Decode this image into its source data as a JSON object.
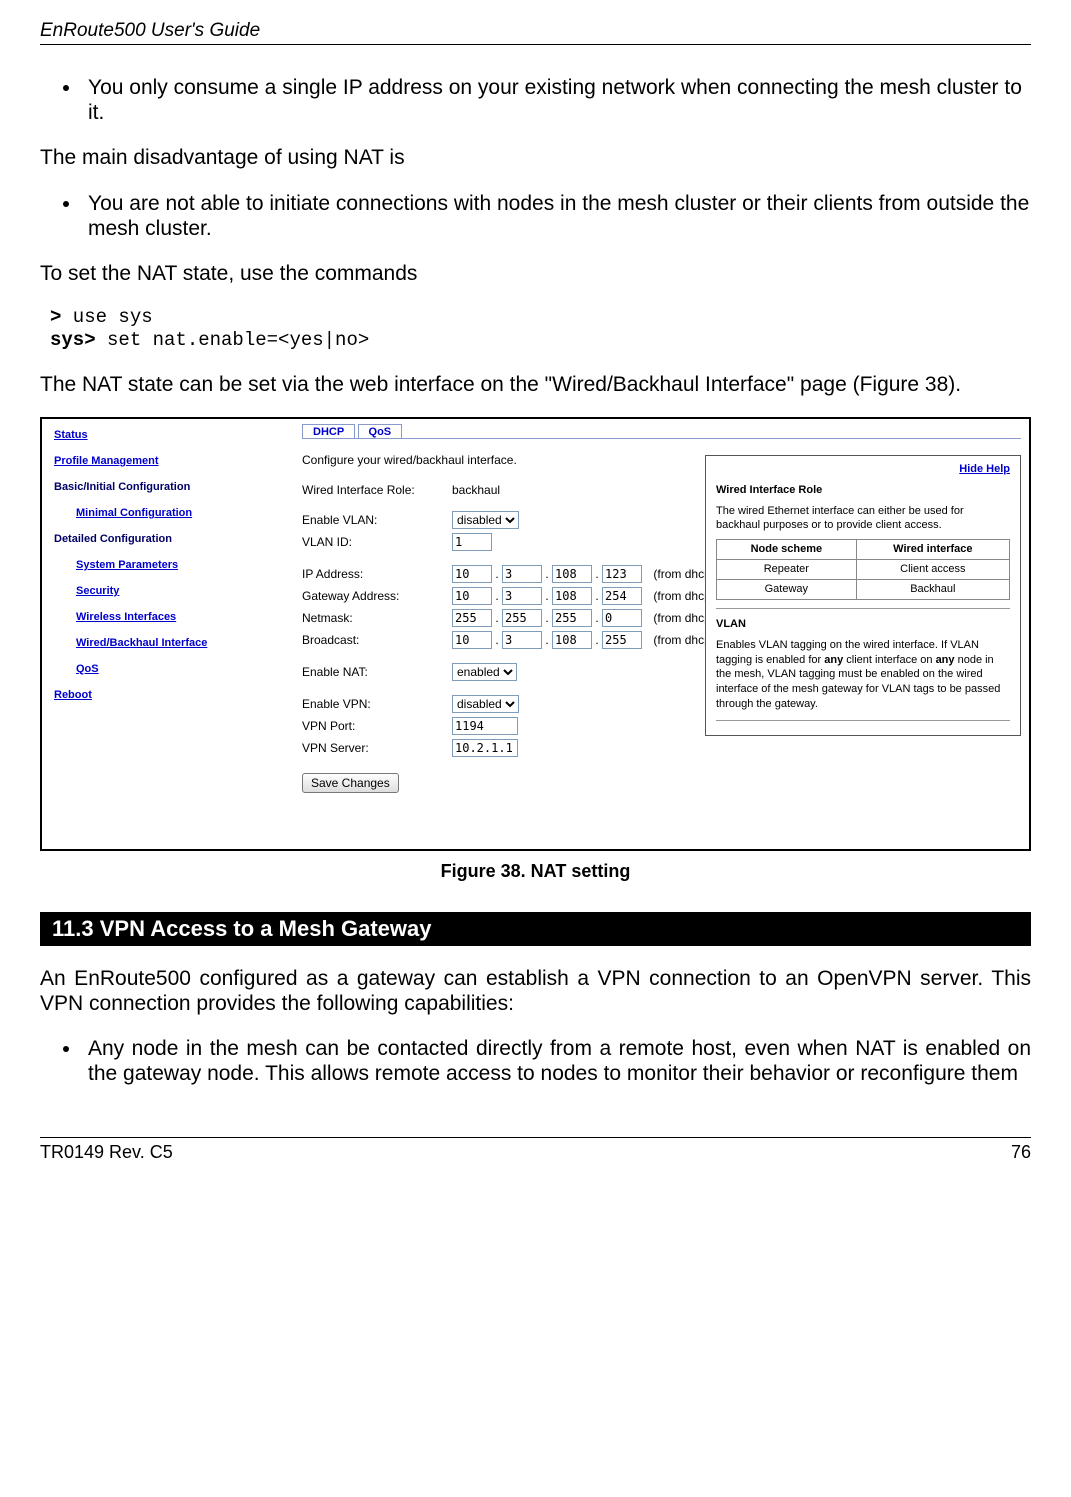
{
  "header": {
    "title": "EnRoute500 User's Guide"
  },
  "content": {
    "bullet1": "You only consume a single IP address on your existing network when connecting the mesh cluster to it.",
    "para1": "The main disadvantage of using NAT is",
    "bullet2": "You are not able to initiate connections with nodes in the mesh cluster or their clients from outside the mesh cluster.",
    "para2": "To set the NAT state, use the commands",
    "cmd": {
      "p1": ">",
      "c1": " use sys",
      "p2": "sys>",
      "c2": " set nat.enable=<yes|no>"
    },
    "para3": "The NAT state can be set via the web interface on the \"Wired/Backhaul Interface\" page (Figure 38).",
    "fig_caption": "Figure 38. NAT setting",
    "section_heading": "11.3    VPN Access to a Mesh Gateway",
    "para4": "An EnRoute500 configured as a gateway can establish a VPN connection to an OpenVPN server. This VPN connection provides the following capabilities:",
    "bullet3": "Any node in the mesh can be contacted directly from a remote host, even when NAT is enabled on the gateway node. This allows remote access to nodes to monitor their behavior or reconfigure them"
  },
  "nav": {
    "status": "Status",
    "profile": "Profile Management",
    "basic": "Basic/Initial Configuration",
    "minimal": "Minimal Configuration",
    "detailed": "Detailed Configuration",
    "sysparam": "System Parameters",
    "security": "Security",
    "wireless": "Wireless Interfaces",
    "wired": "Wired/Backhaul Interface",
    "qos": "QoS",
    "reboot": "Reboot"
  },
  "tabs": {
    "dhcp": "DHCP",
    "qos": "QoS"
  },
  "form": {
    "desc": "Configure your wired/backhaul interface.",
    "role_label": "Wired Interface Role:",
    "role_val": "backhaul",
    "vlan_en_label": "Enable VLAN:",
    "vlan_en_val": "disabled",
    "vlan_id_label": "VLAN ID:",
    "vlan_id_val": "1",
    "ip_label": "IP Address:",
    "ip": {
      "a": "10",
      "b": "3",
      "c": "108",
      "d": "123"
    },
    "gw_label": "Gateway Address:",
    "gw": {
      "a": "10",
      "b": "3",
      "c": "108",
      "d": "254"
    },
    "nm_label": "Netmask:",
    "nm": {
      "a": "255",
      "b": "255",
      "c": "255",
      "d": "0"
    },
    "bc_label": "Broadcast:",
    "bc": {
      "a": "10",
      "b": "3",
      "c": "108",
      "d": "255"
    },
    "dhcp_note": "(from dhcp",
    "nat_label": "Enable NAT:",
    "nat_val": "enabled",
    "vpn_en_label": "Enable VPN:",
    "vpn_en_val": "disabled",
    "vpn_port_label": "VPN Port:",
    "vpn_port_val": "1194",
    "vpn_srv_label": "VPN Server:",
    "vpn_srv_val": "10.2.1.1",
    "save": "Save Changes"
  },
  "help": {
    "hide": "Hide Help",
    "t1": "Wired Interface Role",
    "p1": "The wired Ethernet interface can either be used for backhaul purposes or to provide client access.",
    "th1": "Node scheme",
    "th2": "Wired interface",
    "r1c1": "Repeater",
    "r1c2": "Client access",
    "r2c1": "Gateway",
    "r2c2": "Backhaul",
    "t2": "VLAN",
    "p2a": "Enables VLAN tagging on the wired interface. If VLAN tagging is enabled for ",
    "p2b": "any",
    "p2c": " client interface on ",
    "p2d": "any",
    "p2e": " node in the mesh, VLAN tagging must be enabled on the wired interface of the mesh gateway for VLAN tags to be passed through the gateway."
  },
  "footer": {
    "left": "TR0149 Rev. C5",
    "right": "76"
  }
}
